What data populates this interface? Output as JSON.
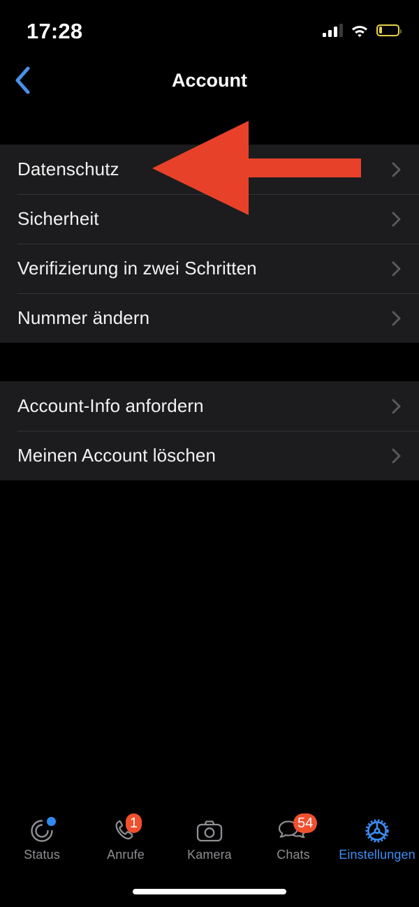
{
  "status_bar": {
    "time": "17:28",
    "cellular_icon": "cellular-signal-icon",
    "cellular_bars_filled": 3,
    "cellular_bars_total": 4,
    "wifi_icon": "wifi-icon",
    "battery_icon": "battery-low-icon",
    "battery_color": "#e8d14a",
    "battery_level_percent": 10
  },
  "nav": {
    "back_icon": "chevron-left-icon",
    "back_color": "#4a90e8",
    "title": "Account"
  },
  "list": {
    "chevron_icon": "chevron-right-icon",
    "chevron_color": "#5a5a5e",
    "row_background": "#1c1c1e",
    "groups": [
      {
        "rows": [
          {
            "label": "Datenschutz"
          },
          {
            "label": "Sicherheit"
          },
          {
            "label": "Verifizierung in zwei Schritten"
          },
          {
            "label": "Nummer ändern"
          }
        ]
      },
      {
        "rows": [
          {
            "label": "Account-Info anfordern"
          },
          {
            "label": "Meinen Account löschen"
          }
        ]
      }
    ]
  },
  "annotation": {
    "arrow_icon": "arrow-left-annotation",
    "color": "#e8412a",
    "points_at": "Datenschutz"
  },
  "tab_bar": {
    "active_color": "#3d8ef5",
    "inactive_color": "#8e8e93",
    "badge_color": "#f0502e",
    "tabs": [
      {
        "label": "Status",
        "icon": "status-rings-icon",
        "active": false,
        "dot": true,
        "badge": ""
      },
      {
        "label": "Anrufe",
        "icon": "phone-icon",
        "active": false,
        "dot": false,
        "badge": "1"
      },
      {
        "label": "Kamera",
        "icon": "camera-icon",
        "active": false,
        "dot": false,
        "badge": ""
      },
      {
        "label": "Chats",
        "icon": "chat-bubbles-icon",
        "active": false,
        "dot": false,
        "badge": "54"
      },
      {
        "label": "Einstellungen",
        "icon": "gear-icon",
        "active": true,
        "dot": false,
        "badge": ""
      }
    ]
  },
  "home_indicator": {
    "icon": "home-indicator"
  }
}
